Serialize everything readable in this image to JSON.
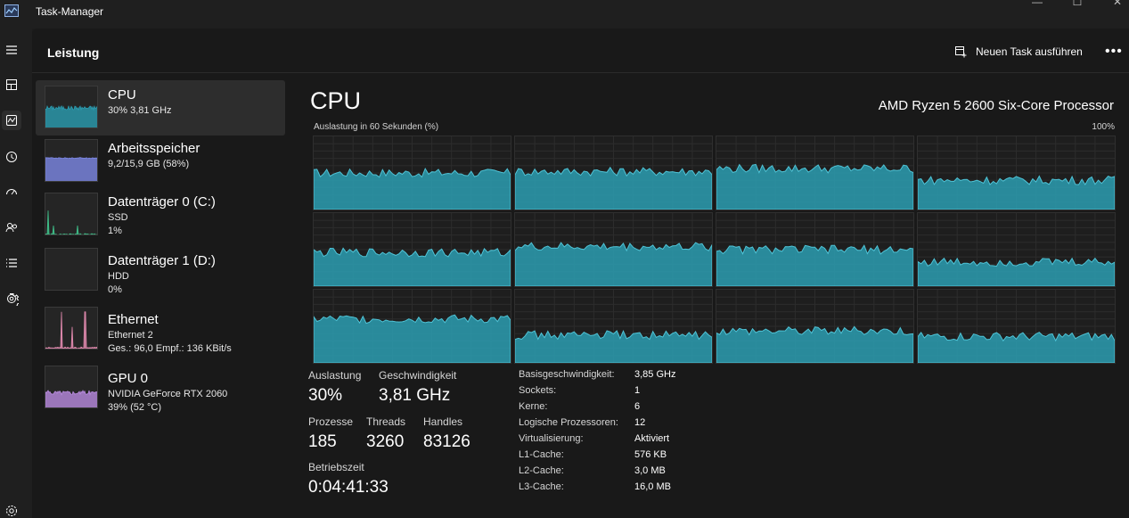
{
  "window": {
    "title": "Task-Manager"
  },
  "header": {
    "title": "Leistung",
    "new_task_label": "Neuen Task ausführen"
  },
  "perf_list": [
    {
      "title": "CPU",
      "lines": [
        "30% 3,81 GHz"
      ],
      "graph_color": "#2b9db2",
      "selected": true
    },
    {
      "title": "Arbeitsspeicher",
      "lines": [
        "9,2/15,9 GB (58%)"
      ],
      "graph_color": "#7d88e6",
      "selected": false
    },
    {
      "title": "Datenträger 0 (C:)",
      "lines": [
        "SSD",
        "1%"
      ],
      "graph_color": "#3fc08a",
      "selected": false
    },
    {
      "title": "Datenträger 1 (D:)",
      "lines": [
        "HDD",
        "0%"
      ],
      "graph_color": "#3fc08a",
      "selected": false
    },
    {
      "title": "Ethernet",
      "lines": [
        "Ethernet 2",
        "Ges.: 96,0 Empf.: 136 KBit/s"
      ],
      "graph_color": "#e48bb0",
      "selected": false
    },
    {
      "title": "GPU 0",
      "lines": [
        "NVIDIA GeForce RTX 2060",
        "39% (52 °C)"
      ],
      "graph_color": "#b98be0",
      "selected": false
    }
  ],
  "detail": {
    "title": "CPU",
    "model": "AMD Ryzen 5 2600 Six-Core Processor",
    "graph_label": "Auslastung in 60 Sekunden (%)",
    "graph_max": "100%",
    "graph_color": "#2b9db2",
    "core_levels": [
      0.5,
      0.52,
      0.56,
      0.4,
      0.46,
      0.54,
      0.5,
      0.33,
      0.6,
      0.38,
      0.44,
      0.36
    ],
    "stats": {
      "auslastung_label": "Auslastung",
      "auslastung_value": "30%",
      "geschwindigkeit_label": "Geschwindigkeit",
      "geschwindigkeit_value": "3,81 GHz",
      "prozesse_label": "Prozesse",
      "prozesse_value": "185",
      "threads_label": "Threads",
      "threads_value": "3260",
      "handles_label": "Handles",
      "handles_value": "83126",
      "betriebszeit_label": "Betriebszeit",
      "betriebszeit_value": "0:04:41:33"
    },
    "specs": [
      {
        "label": "Basisgeschwindigkeit:",
        "value": "3,85 GHz"
      },
      {
        "label": "Sockets:",
        "value": "1"
      },
      {
        "label": "Kerne:",
        "value": "6"
      },
      {
        "label": "Logische Prozessoren:",
        "value": "12"
      },
      {
        "label": "Virtualisierung:",
        "value": "Aktiviert"
      },
      {
        "label": "L1-Cache:",
        "value": "576 KB"
      },
      {
        "label": "L2-Cache:",
        "value": "3,0 MB"
      },
      {
        "label": "L3-Cache:",
        "value": "16,0 MB"
      }
    ]
  },
  "icons": {
    "rail": [
      "hamburger-icon",
      "processes-icon",
      "performance-icon",
      "app-history-icon",
      "startup-icon",
      "users-icon",
      "details-icon",
      "services-icon",
      "settings-icon"
    ]
  }
}
